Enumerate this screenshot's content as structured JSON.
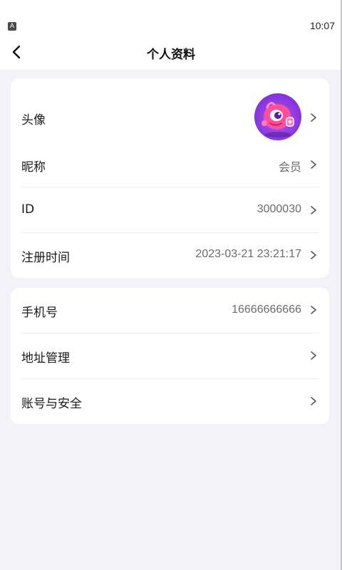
{
  "status_bar": {
    "time": "10:07",
    "app_icon_letter": "A"
  },
  "header": {
    "title": "个人资料",
    "back_icon": "chevron-left-icon"
  },
  "profile_card": {
    "avatar_row": {
      "label": "头像"
    },
    "nickname": {
      "label": "昵称",
      "value": "会员"
    },
    "id": {
      "label": "ID",
      "value": "3000030"
    },
    "register_time": {
      "label": "注册时间",
      "value": "2023-03-21 23:21:17"
    }
  },
  "account_card": {
    "phone": {
      "label": "手机号",
      "value": "16666666666"
    },
    "address": {
      "label": "地址管理"
    },
    "security": {
      "label": "账号与安全"
    }
  },
  "colors": {
    "background": "#f2f2f8",
    "card": "#ffffff",
    "avatar_purple": "#8a37e0",
    "mascot_pink": "#ff4f9a"
  }
}
